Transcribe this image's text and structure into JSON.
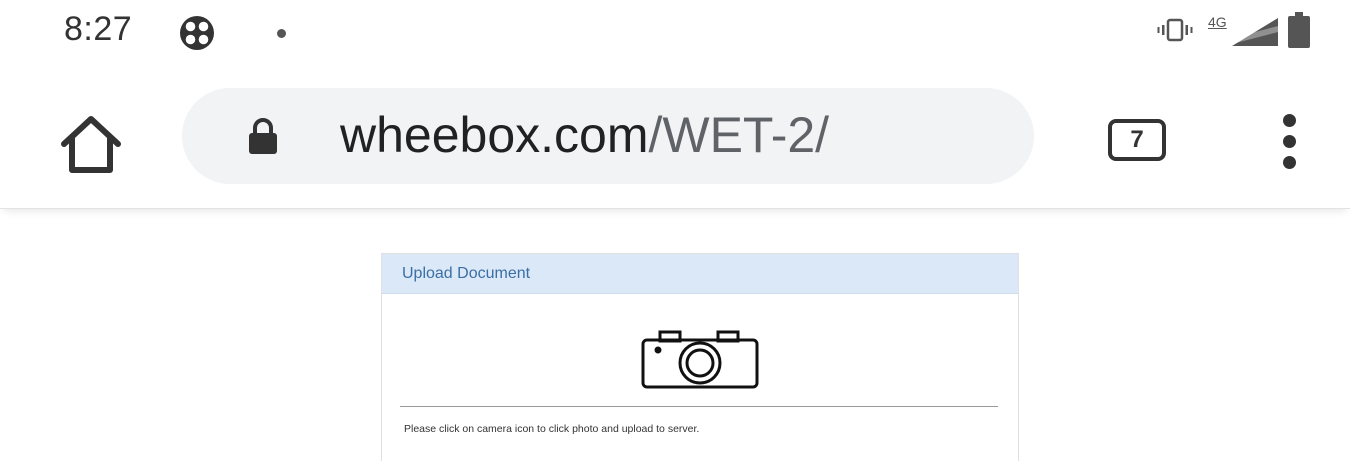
{
  "status_bar": {
    "time": "8:27",
    "network_label": "4G",
    "icons": [
      "app-notification-icon",
      "vibrate-icon",
      "signal-icon",
      "battery-icon"
    ]
  },
  "browser": {
    "url_host": "wheebox.com",
    "url_path": "/WET-2/",
    "tab_count": "7",
    "icons": [
      "home-icon",
      "lock-icon",
      "tabs-icon",
      "more-vert-icon"
    ]
  },
  "upload_card": {
    "title": "Upload Document",
    "camera_icon": "camera-icon",
    "instruction": "Please click on camera icon to click photo and upload to server."
  },
  "colors": {
    "card_header_bg": "#dbe8f7",
    "card_title": "#3b6ea5",
    "omnibox_bg": "#f1f3f4"
  }
}
